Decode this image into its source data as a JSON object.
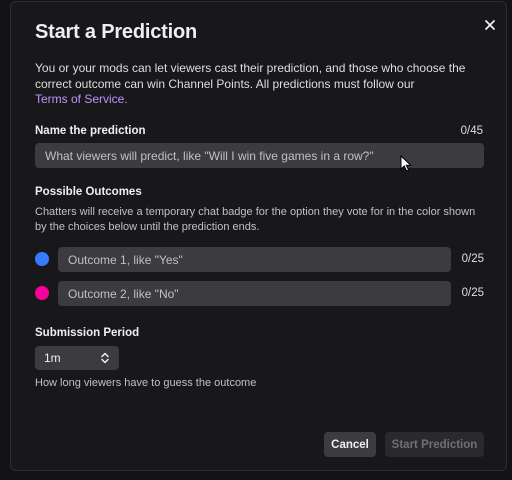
{
  "modal": {
    "title": "Start a Prediction",
    "description": "You or your mods can let viewers cast their prediction, and those who choose the correct outcome can win Channel Points. All predictions must follow our",
    "tos_link": "Terms of Service."
  },
  "prediction": {
    "label": "Name the prediction",
    "counter": "0/45",
    "placeholder": "What viewers will predict, like \"Will I win five games in a row?\""
  },
  "outcomes": {
    "label": "Possible Outcomes",
    "helper": "Chatters will receive a temporary chat badge for the option they vote for in the color shown by the choices below until the prediction ends.",
    "items": [
      {
        "placeholder": "Outcome 1, like \"Yes\"",
        "counter": "0/25",
        "color": "#387aff"
      },
      {
        "placeholder": "Outcome 2, like \"No\"",
        "counter": "0/25",
        "color": "#f5009b"
      }
    ]
  },
  "submission": {
    "label": "Submission Period",
    "value": "1m",
    "helper": "How long viewers have to guess the outcome"
  },
  "buttons": {
    "cancel": "Cancel",
    "start": "Start Prediction"
  },
  "icons": {
    "close": "close-icon",
    "chevron": "chevron-up-down-icon",
    "cursor": "mouse-pointer-icon"
  }
}
